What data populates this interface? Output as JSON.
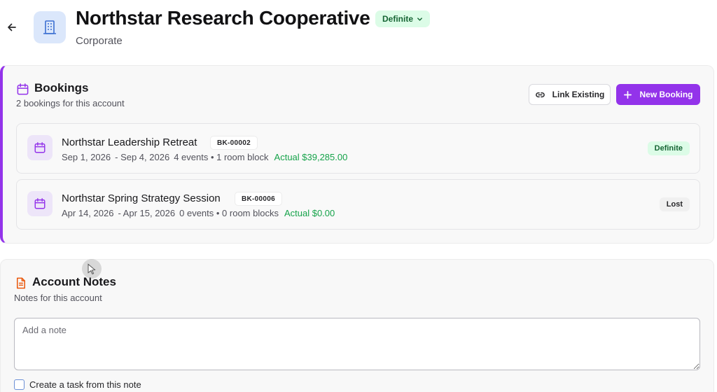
{
  "header": {
    "title": "Northstar Research Cooperative",
    "status": "Definite",
    "account_type": "Corporate"
  },
  "bookings": {
    "title": "Bookings",
    "subtitle": "2 bookings for this account",
    "link_existing_label": "Link Existing",
    "new_booking_label": "New Booking",
    "items": [
      {
        "name": "Northstar Leadership Retreat",
        "id": "BK-00002",
        "start": "Sep 1, 2026",
        "end": "- Sep 4, 2026",
        "stats": "4 events • 1 room block",
        "actual": "Actual $39,285.00",
        "status": "Definite"
      },
      {
        "name": "Northstar Spring Strategy Session",
        "id": "BK-00006",
        "start": "Apr 14, 2026",
        "end": "- Apr 15, 2026",
        "stats": "0 events • 0 room blocks",
        "actual": "Actual $0.00",
        "status": "Lost"
      }
    ]
  },
  "notes": {
    "title": "Account Notes",
    "subtitle": "Notes for this account",
    "placeholder": "Add a note",
    "task_label": "Create a task from this note"
  },
  "colors": {
    "accent": "#9333ea",
    "success_text": "#16a34a",
    "definite_bg": "#dcfce7",
    "account_icon_bg": "#dbe7fb"
  },
  "icons": {
    "back": "arrow-left-icon",
    "account": "building-icon",
    "bookings": "calendar-icon",
    "link": "link-icon",
    "add": "plus-icon",
    "notes": "document-icon"
  }
}
